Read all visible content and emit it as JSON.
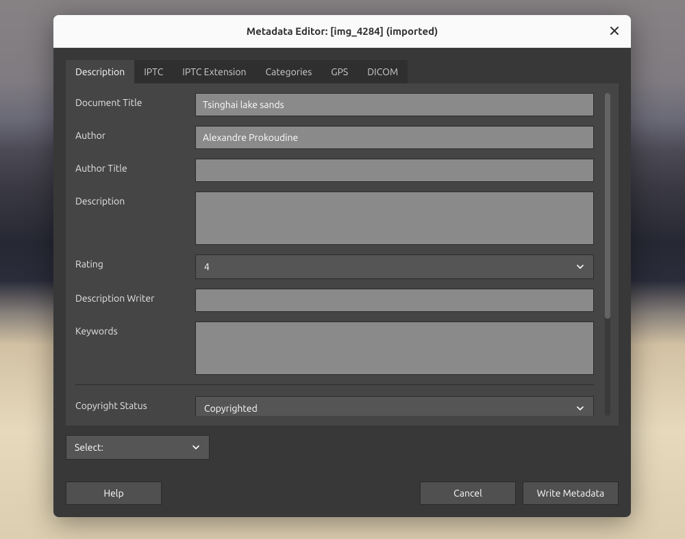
{
  "window": {
    "title": "Metadata Editor: [img_4284] (imported)"
  },
  "tabs": {
    "t0": "Description",
    "t1": "IPTC",
    "t2": "IPTC Extension",
    "t3": "Categories",
    "t4": "GPS",
    "t5": "DICOM"
  },
  "labels": {
    "document_title": "Document Title",
    "author": "Author",
    "author_title": "Author Title",
    "description": "Description",
    "rating": "Rating",
    "description_writer": "Description Writer",
    "keywords": "Keywords",
    "copyright_status": "Copyright Status"
  },
  "values": {
    "document_title": "Tsinghai lake sands",
    "author": "Alexandre Prokoudine",
    "author_title": "",
    "description": "",
    "rating": "4",
    "description_writer": "",
    "keywords": "",
    "copyright_status": "Copyrighted"
  },
  "bottom_select": {
    "label": "Select:"
  },
  "buttons": {
    "help": "Help",
    "cancel": "Cancel",
    "write_metadata": "Write Metadata"
  }
}
